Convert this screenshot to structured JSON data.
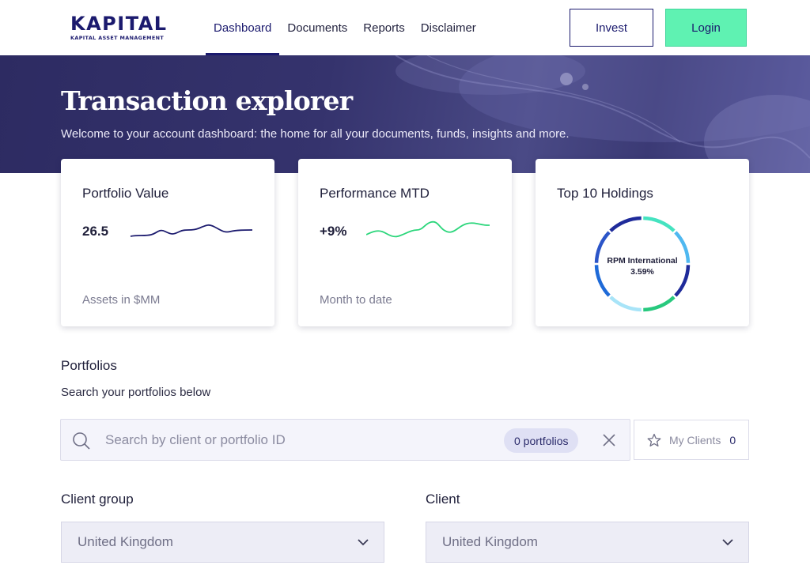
{
  "brand": {
    "name": "KAPITAL",
    "tagline": "KAPITAL ASSET MANAGEMENT",
    "color": "#1b1a6e",
    "accent": "#5ff2b2"
  },
  "nav": {
    "items": [
      "Dashboard",
      "Documents",
      "Reports",
      "Disclaimer"
    ],
    "active": "Dashboard"
  },
  "header_buttons": {
    "invest": "Invest",
    "login": "Login"
  },
  "hero": {
    "title": "Transaction explorer",
    "subtitle": "Welcome to your account dashboard: the home for all your documents, funds, insights and more."
  },
  "cards": {
    "portfolio": {
      "title": "Portfolio Value",
      "value": "26.5",
      "footer": "Assets in $MM",
      "line_color": "#1b1a6e"
    },
    "performance": {
      "title": "Performance MTD",
      "value": "+9%",
      "footer": "Month to date",
      "line_color": "#2bd67b"
    },
    "holdings": {
      "title": "Top 10 Holdings",
      "center_name": "RPM International",
      "center_value": "3.59%",
      "segment_colors": [
        "#45e3c0",
        "#4fb8f0",
        "#1f2b9a",
        "#28c97e",
        "#a8e4f8",
        "#1e6ad8",
        "#2b55c8",
        "#1f2b9a"
      ]
    }
  },
  "portfolios": {
    "title": "Portfolios",
    "subtitle": "Search your portfolios below",
    "search_placeholder": "Search by client or portfolio ID",
    "count_badge": "0 portfolios",
    "my_clients_label": "My Clients",
    "my_clients_count": "0"
  },
  "filters": {
    "client_group": {
      "label": "Client group",
      "value": "United Kingdom"
    },
    "client": {
      "label": "Client",
      "value": "United Kingdom"
    }
  },
  "icons": {
    "search": "search-icon",
    "close": "close-icon",
    "star": "star-icon",
    "chevron": "chevron-down-icon"
  }
}
